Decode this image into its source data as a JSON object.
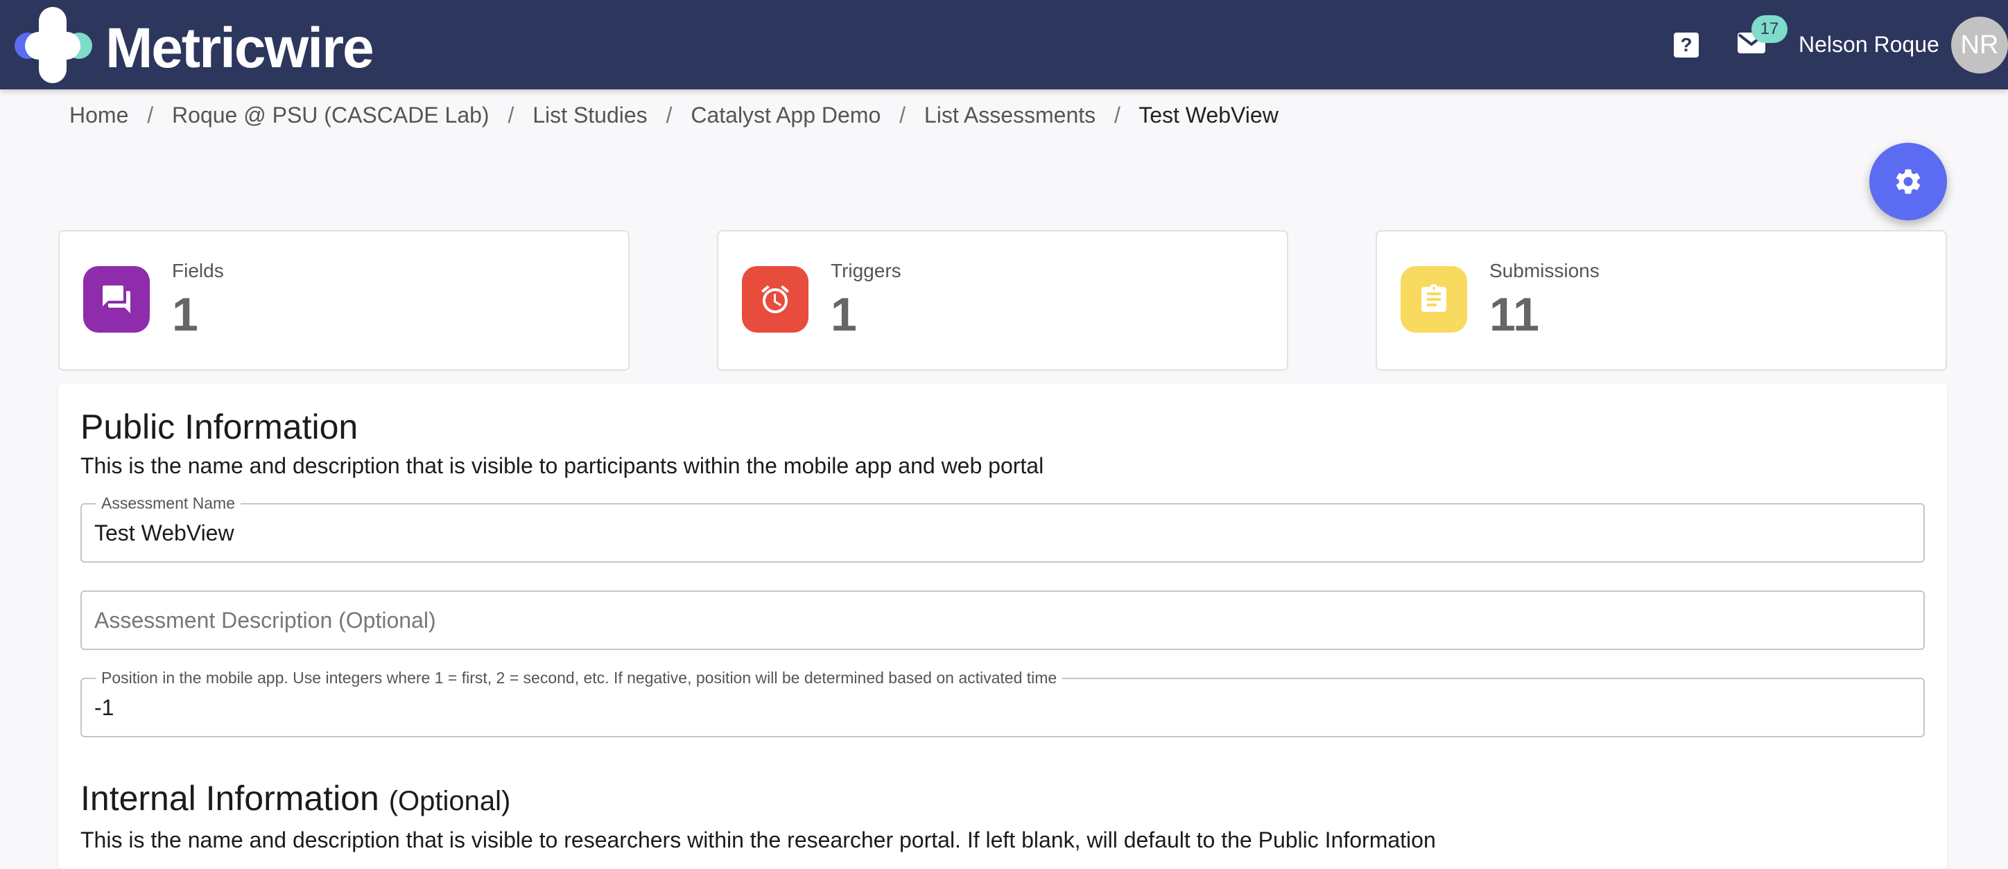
{
  "header": {
    "brand": "Metricwire",
    "help_label": "?",
    "mail_count": "17",
    "user_name": "Nelson Roque",
    "avatar_initials": "NR",
    "colors": {
      "bar": "#2d375d",
      "logo_blue": "#5b6cf2",
      "logo_teal": "#7fdccb"
    }
  },
  "breadcrumb": {
    "items": [
      "Home",
      "Roque @ PSU (CASCADE Lab)",
      "List Studies",
      "Catalyst App Demo",
      "List Assessments"
    ],
    "current": "Test WebView",
    "separator": "/"
  },
  "fab": {
    "icon": "gear-icon",
    "color": "#5b6cf2"
  },
  "stats": [
    {
      "label": "Fields",
      "value": "1",
      "icon": "chat-icon",
      "color": "#8e2cab"
    },
    {
      "label": "Triggers",
      "value": "1",
      "icon": "alarm-clock-icon",
      "color": "#e84c3d"
    },
    {
      "label": "Submissions",
      "value": "11",
      "icon": "clipboard-icon",
      "color": "#f8da5f"
    }
  ],
  "public_info": {
    "title": "Public Information",
    "description": "This is the name and description that is visible to participants within the mobile app and web portal",
    "name_label": "Assessment Name",
    "name_value": "Test WebView",
    "description_placeholder": "Assessment Description (Optional)",
    "description_value": "",
    "position_label": "Position in the mobile app. Use integers where 1 = first, 2 = second, etc. If negative, position will be determined based on activated time",
    "position_value": "-1"
  },
  "internal_info": {
    "title": "Internal Information",
    "title_suffix": "(Optional)",
    "description": "This is the name and description that is visible to researchers within the researcher portal. If left blank, will default to the Public Information"
  }
}
